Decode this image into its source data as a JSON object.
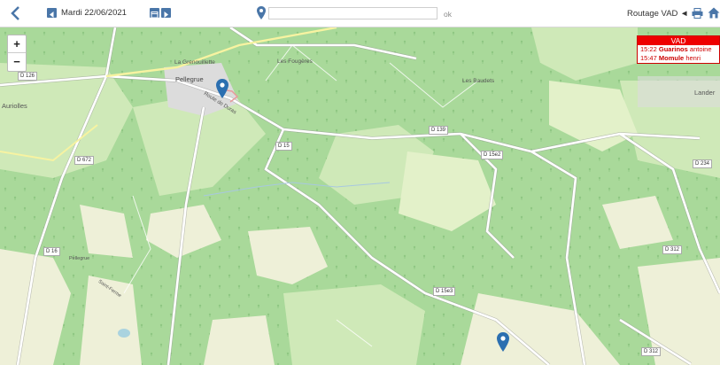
{
  "toolbar": {
    "date": "Mardi 22/06/2021",
    "search_value": "",
    "ok_label": "ok",
    "routage_label": "Routage VAD ◄",
    "icons": [
      "back-icon",
      "prev-day-icon",
      "calendar-icon",
      "next-day-icon",
      "map-pin-icon",
      "print-icon",
      "home-icon"
    ]
  },
  "zoom": {
    "in_label": "+",
    "out_label": "−"
  },
  "vad": {
    "title": "VAD",
    "visits": [
      {
        "time": "15:22",
        "lastname": "Guarinos",
        "firstname": "antoine"
      },
      {
        "time": "15:47",
        "lastname": "Momule",
        "firstname": "henri"
      }
    ]
  },
  "map": {
    "places": {
      "la_grenouillette": "La Grenouillette",
      "pellegrue": "Pellegrue",
      "les_fougeres": "Les Fougères",
      "les_baudets": "Les Baudets",
      "auriolles": "Auriolles",
      "landerr": "Lander",
      "route_de_duras": "Route de Duras",
      "pellegrue_south": "Pellegrue",
      "saint_ferme": "Saint-Ferme"
    },
    "roads": {
      "d126": "D 126",
      "d139": "D 139",
      "d15": "D 15",
      "d672": "D 672",
      "d15e2": "D 15e2",
      "d234": "D 234",
      "d16": "D 16",
      "d312a": "D 312",
      "d15e3": "D 15e3",
      "d312b": "D 312"
    },
    "colors": {
      "forest": "#a9d99a",
      "field": "#cfe9b8",
      "clearing": "#eef0d8",
      "road": "#ffffff",
      "accent": "#4a76a8"
    }
  }
}
